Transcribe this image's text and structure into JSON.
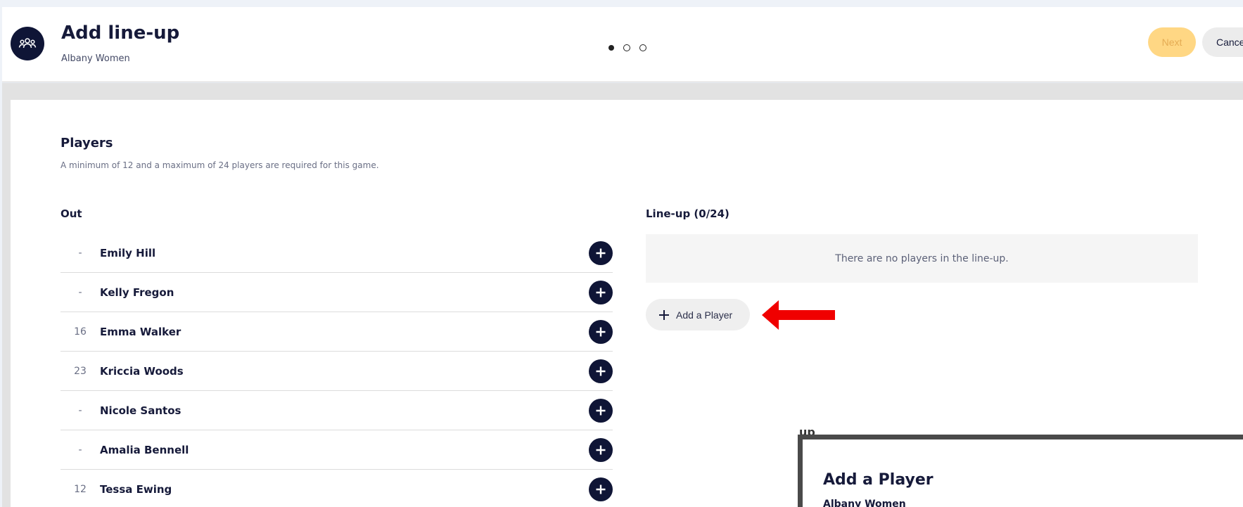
{
  "header": {
    "title": "Add line-up",
    "subtitle": "Albany Women",
    "avatar_icon": "team-users-icon",
    "steps": {
      "total": 3,
      "current": 1
    },
    "next_label": "Next",
    "cancel_label": "Cance"
  },
  "players_section": {
    "title": "Players",
    "description": "A minimum of 12 and a maximum of 24 players are required for this game."
  },
  "out_list": {
    "heading": "Out",
    "add_icon": "plus-circle-icon",
    "players": [
      {
        "number": "-",
        "name": "Emily Hill"
      },
      {
        "number": "-",
        "name": "Kelly Fregon"
      },
      {
        "number": "16",
        "name": "Emma Walker"
      },
      {
        "number": "23",
        "name": "Kriccia Woods"
      },
      {
        "number": "-",
        "name": "Nicole Santos"
      },
      {
        "number": "-",
        "name": "Amalia Bennell"
      },
      {
        "number": "12",
        "name": "Tessa Ewing"
      }
    ]
  },
  "lineup": {
    "heading": "Line-up (0/24)",
    "empty_text": "There are no players in the line-up.",
    "add_player_label": "Add a Player",
    "annotation_arrow_color": "#f00000"
  },
  "modal": {
    "peek_text": "up",
    "title": "Add a Player",
    "subtitle": "Albany Women"
  },
  "colors": {
    "primary_dark": "#0f1536",
    "next_bg": "#ffd784",
    "next_text": "#e5ac54"
  }
}
